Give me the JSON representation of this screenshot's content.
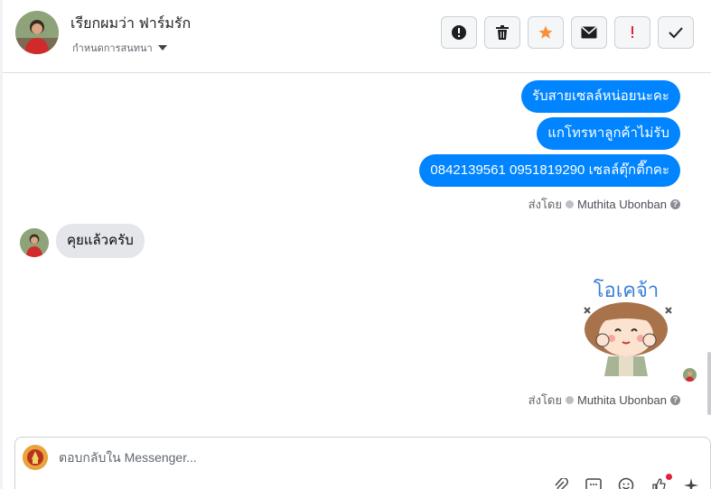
{
  "conversation": {
    "contact_name": "เรียกผมว่า ฟาร์มรัก",
    "assign_label": "กำหนดการสนทนา"
  },
  "toolbar": {
    "buttons": [
      {
        "name": "mark-spam-button",
        "icon": "exclamation-circle-icon"
      },
      {
        "name": "delete-button",
        "icon": "trash-icon"
      },
      {
        "name": "star-button",
        "icon": "star-icon",
        "color": "#f7923a"
      },
      {
        "name": "mark-unread-button",
        "icon": "envelope-icon"
      },
      {
        "name": "follow-up-button",
        "icon": "exclamation-icon",
        "color": "#e41e3f"
      },
      {
        "name": "mark-done-button",
        "icon": "check-icon"
      }
    ]
  },
  "messages": {
    "outgoing_1": "รับสายเซลล์หน่อยนะคะ",
    "outgoing_2": "แกโทรหาลูกค้าไม่รับ",
    "outgoing_3": "0842139561    0951819290 เซลล์ตุ๊กตี๊กคะ",
    "sent_by_prefix": "ส่งโดย",
    "sent_by_agent": "Muthita Ubonban",
    "help_mark": "?",
    "incoming_1": "คุยแล้วครับ",
    "sticker_text": "โอเคจ้า"
  },
  "composer": {
    "placeholder": "ตอบกลับใน Messenger..."
  },
  "colors": {
    "outgoing_bubble": "#0084ff",
    "incoming_bubble": "#e4e6eb",
    "star": "#f7923a",
    "alert": "#e41e3f"
  }
}
